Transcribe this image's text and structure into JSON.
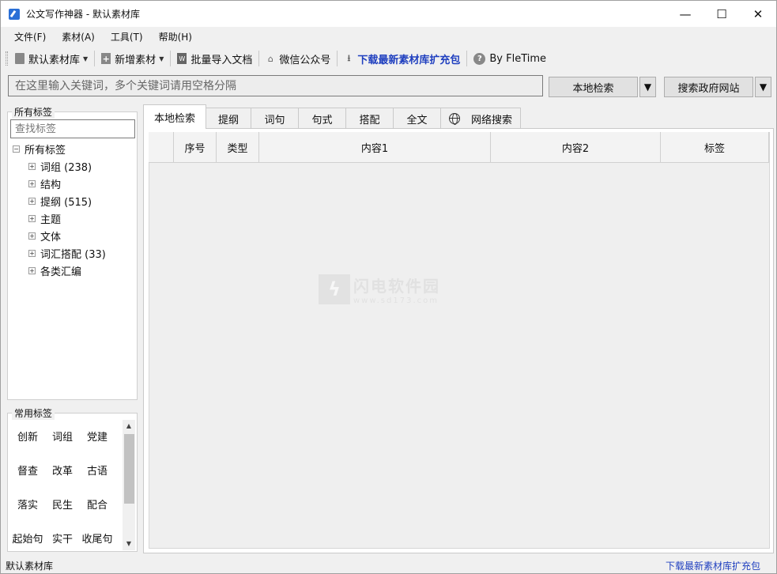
{
  "window": {
    "title": "公文写作神器  -  默认素材库",
    "minimize": "—",
    "maximize": "☐",
    "close": "✕"
  },
  "menu": [
    "文件(F)",
    "素材(A)",
    "工具(T)",
    "帮助(H)"
  ],
  "toolbar": {
    "library": "默认素材库",
    "add": "新增素材",
    "import": "批量导入文档",
    "wechat": "微信公众号",
    "download": "下载最新素材库扩充包",
    "about": "By FleTime"
  },
  "search": {
    "placeholder": "在这里输入关键词，多个关键词请用空格分隔",
    "local_btn": "本地检索",
    "gov_btn": "搜索政府网站",
    "dropdown": "▼"
  },
  "all_tags": {
    "title": "所有标签",
    "search_placeholder": "查找标签",
    "root": "所有标签",
    "items": [
      {
        "label": "词组  (238)"
      },
      {
        "label": "结构"
      },
      {
        "label": "提纲  (515)"
      },
      {
        "label": "主题"
      },
      {
        "label": "文体"
      },
      {
        "label": "词汇搭配  (33)"
      },
      {
        "label": "各类汇编"
      }
    ]
  },
  "common_tags": {
    "title": "常用标签",
    "items": [
      "创新",
      "词组",
      "党建",
      "督查",
      "改革",
      "古语",
      "落实",
      "民生",
      "配合",
      "起始句",
      "实干",
      "收尾句"
    ]
  },
  "tabs": [
    "本地检索",
    "提纲",
    "词句",
    "句式",
    "搭配",
    "全文",
    "网络搜索"
  ],
  "table": {
    "columns": [
      "",
      "序号",
      "类型",
      "内容1",
      "内容2",
      "标签"
    ]
  },
  "watermark": {
    "text": "闪电软件园",
    "url": "www.sd173.com"
  },
  "status": {
    "left": "默认素材库",
    "right": "下载最新素材库扩充包"
  }
}
